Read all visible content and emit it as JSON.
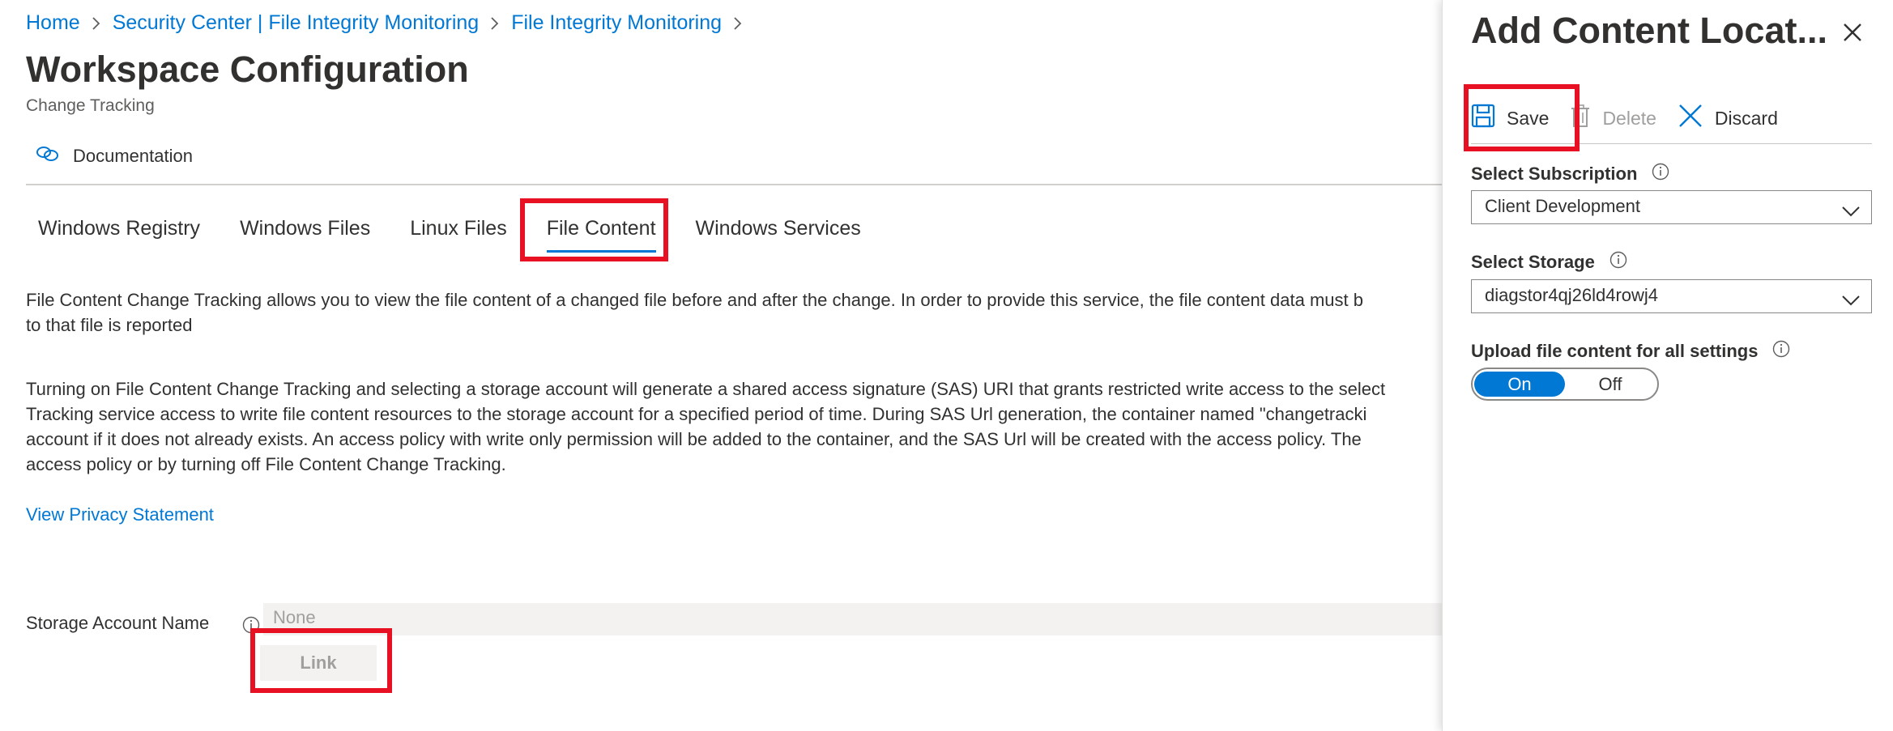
{
  "breadcrumb": [
    {
      "label": "Home"
    },
    {
      "label": "Security Center | File Integrity Monitoring"
    },
    {
      "label": "File Integrity Monitoring"
    }
  ],
  "page": {
    "title": "Workspace Configuration",
    "subtitle": "Change Tracking"
  },
  "documentation_label": "Documentation",
  "tabs": [
    {
      "label": "Windows Registry"
    },
    {
      "label": "Windows Files"
    },
    {
      "label": "Linux Files"
    },
    {
      "label": "File Content"
    },
    {
      "label": "Windows Services"
    }
  ],
  "content": {
    "para1": [
      "File Content Change Tracking allows you to view the file content of a changed file before and after the change. In order to provide this service, the file content data must b",
      "to that file is reported"
    ],
    "para2": [
      "Turning on File Content Change Tracking and selecting a storage account will generate a shared access signature (SAS) URI that grants restricted write access to the select",
      "Tracking service access to write file content resources to the storage account for a specified period of time. During SAS Url generation, the container named \"changetracki",
      "account if it does not already exists. An access policy with write only permission will be added to the container, and the SAS Url will be created with the access policy. The",
      "access policy or by turning off File Content Change Tracking."
    ],
    "privacy_link": "View Privacy Statement",
    "storage_label": "Storage Account Name",
    "storage_value": "None",
    "link_button": "Link"
  },
  "panel": {
    "title": "Add Content Locat...",
    "commands": {
      "save": "Save",
      "delete": "Delete",
      "discard": "Discard"
    },
    "subscription_label": "Select Subscription",
    "subscription_value": "Client Development",
    "storage_label": "Select Storage",
    "storage_value": "diagstor4qj26ld4rowj4",
    "upload_label": "Upload file content for all settings",
    "toggle_on": "On",
    "toggle_off": "Off",
    "toggle_selected": "On"
  },
  "colors": {
    "accent": "#0078d4",
    "highlight": "#e81123",
    "text": "#323130",
    "disabled": "#a19f9d"
  }
}
